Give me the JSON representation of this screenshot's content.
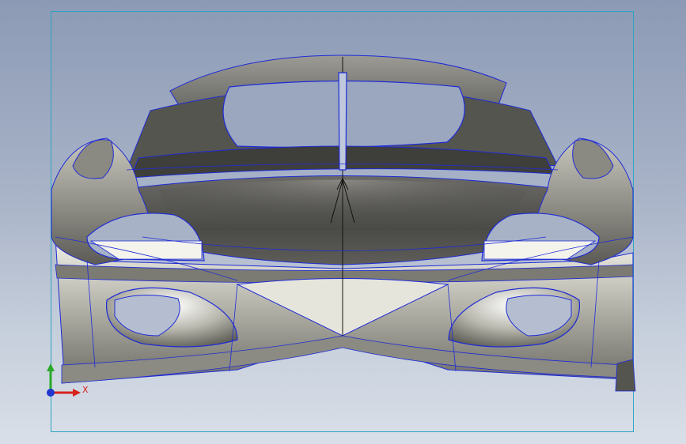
{
  "app": {
    "view": "cad-3d-viewport"
  },
  "model": {
    "name": "car-body-front-surface"
  },
  "triad": {
    "x_label": "X",
    "icons": [
      "x-axis-arrow-icon",
      "y-axis-arrow-icon",
      "z-axis-dot-icon"
    ]
  },
  "colors": {
    "background_top": "#8c9ab5",
    "background_bottom": "#d9dfe8",
    "frame": "#2ea3c4",
    "edge_lines": "#1f2bd6",
    "body_dark": "#4a4a48",
    "body_light": "#e9e8df",
    "x_axis": "#d8221e",
    "y_axis": "#29a829",
    "z_axis": "#2037d0"
  }
}
